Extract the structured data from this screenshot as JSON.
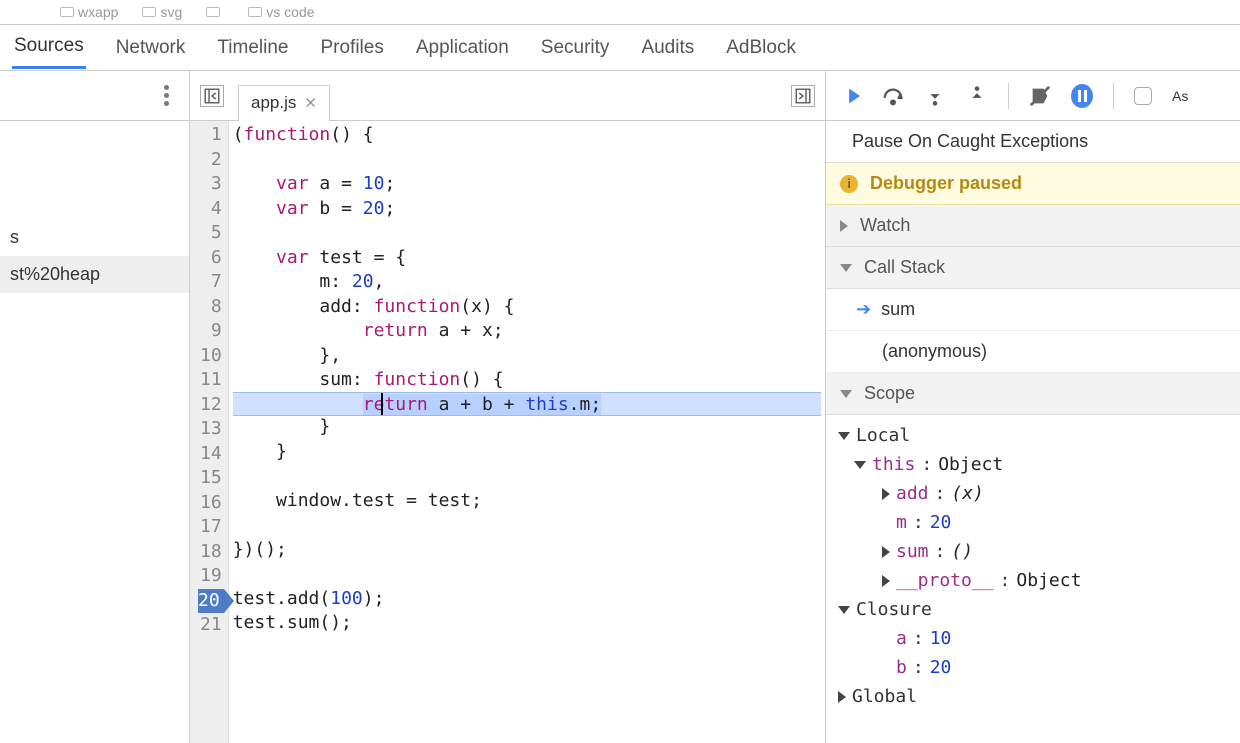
{
  "top_folders": [
    "wxapp",
    "svg",
    "",
    "vs code"
  ],
  "tabs": [
    "Sources",
    "Network",
    "Timeline",
    "Profiles",
    "Application",
    "Security",
    "Audits",
    "AdBlock"
  ],
  "active_tab": "Sources",
  "left": {
    "items": [
      "s",
      "st%20heap"
    ]
  },
  "editor": {
    "filename": "app.js",
    "code_lines": [
      {
        "n": 1,
        "tokens": [
          [
            "",
            "("
          ],
          [
            "kw",
            "function"
          ],
          [
            "",
            "() {"
          ]
        ]
      },
      {
        "n": 2,
        "tokens": []
      },
      {
        "n": 3,
        "tokens": [
          [
            "",
            "    "
          ],
          [
            "kw",
            "var"
          ],
          [
            "",
            " a = "
          ],
          [
            "num",
            "10"
          ],
          [
            "",
            ";"
          ]
        ]
      },
      {
        "n": 4,
        "tokens": [
          [
            "",
            "    "
          ],
          [
            "kw",
            "var"
          ],
          [
            "",
            " b = "
          ],
          [
            "num",
            "20"
          ],
          [
            "",
            ";"
          ]
        ]
      },
      {
        "n": 5,
        "tokens": []
      },
      {
        "n": 6,
        "tokens": [
          [
            "",
            "    "
          ],
          [
            "kw",
            "var"
          ],
          [
            "",
            " test = {"
          ]
        ]
      },
      {
        "n": 7,
        "tokens": [
          [
            "",
            "        m: "
          ],
          [
            "num",
            "20"
          ],
          [
            "",
            ","
          ]
        ]
      },
      {
        "n": 8,
        "tokens": [
          [
            "",
            "        add: "
          ],
          [
            "kw",
            "function"
          ],
          [
            "",
            "(x) {"
          ]
        ]
      },
      {
        "n": 9,
        "tokens": [
          [
            "",
            "            "
          ],
          [
            "kw",
            "return"
          ],
          [
            "",
            " a + x;"
          ]
        ]
      },
      {
        "n": 10,
        "tokens": [
          [
            "",
            "        },"
          ]
        ]
      },
      {
        "n": 11,
        "tokens": [
          [
            "",
            "        sum: "
          ],
          [
            "kw",
            "function"
          ],
          [
            "",
            "() {"
          ]
        ]
      },
      {
        "n": 12,
        "hl": true,
        "tokens": [
          [
            "",
            "            "
          ],
          [
            "kwsel",
            "return"
          ],
          [
            "sel",
            " a + b + "
          ],
          [
            "thissel",
            "this"
          ],
          [
            "sel",
            ".m;"
          ]
        ]
      },
      {
        "n": 13,
        "tokens": [
          [
            "",
            "        }"
          ]
        ]
      },
      {
        "n": 14,
        "tokens": [
          [
            "",
            "    }"
          ]
        ]
      },
      {
        "n": 15,
        "tokens": []
      },
      {
        "n": 16,
        "tokens": [
          [
            "",
            "    window.test = test;"
          ]
        ]
      },
      {
        "n": 17,
        "tokens": []
      },
      {
        "n": 18,
        "tokens": [
          [
            "",
            "})();"
          ]
        ]
      },
      {
        "n": 19,
        "tokens": []
      },
      {
        "n": 20,
        "bp": true,
        "tokens": [
          [
            "",
            "test.add("
          ],
          [
            "num",
            "100"
          ],
          [
            "",
            ");"
          ]
        ]
      },
      {
        "n": 21,
        "tokens": [
          [
            "",
            "test.sum();"
          ]
        ]
      }
    ]
  },
  "debugger": {
    "pause_caught_label": "Pause On Caught Exceptions",
    "banner_text": "Debugger paused",
    "watch_label": "Watch",
    "callstack_label": "Call Stack",
    "callstack": [
      "sum",
      "(anonymous)"
    ],
    "scope_label": "Scope",
    "as_label": "As",
    "scope": {
      "local_label": "Local",
      "this_label": "this",
      "this_type": "Object",
      "this_props": [
        {
          "k": "add",
          "v": "(x)",
          "italic": true,
          "expand": true
        },
        {
          "k": "m",
          "v": "20",
          "num": true
        },
        {
          "k": "sum",
          "v": "()",
          "italic": true,
          "expand": true
        },
        {
          "k": "__proto__",
          "v": "Object",
          "expand": true
        }
      ],
      "closure_label": "Closure",
      "closure": [
        {
          "k": "a",
          "v": "10"
        },
        {
          "k": "b",
          "v": "20"
        }
      ],
      "global_label": "Global"
    }
  }
}
